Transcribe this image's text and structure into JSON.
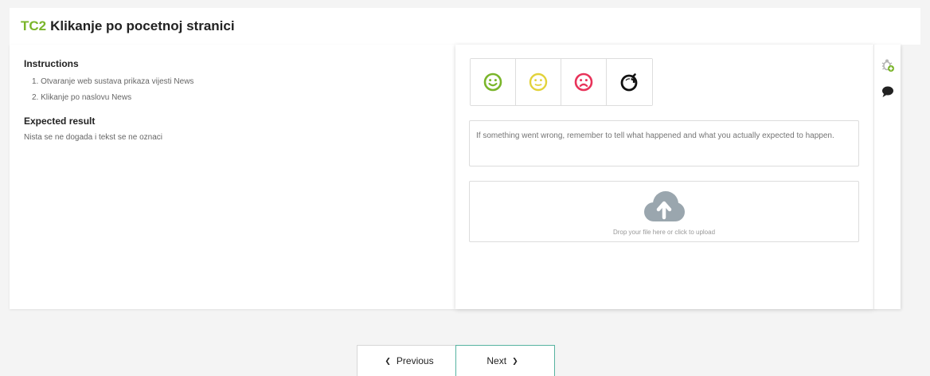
{
  "header": {
    "code": "TC2",
    "title": "Klikanje po pocetnoj stranici"
  },
  "instructions": {
    "heading": "Instructions",
    "steps": [
      "1. Otvaranje web sustava prikaza vijesti News",
      "2. Klikanje po naslovu News"
    ]
  },
  "expected": {
    "heading": "Expected result",
    "text": "Nista se ne dogada i tekst se ne oznaci"
  },
  "feedback": {
    "emojis": [
      {
        "icon": "happy-face-icon",
        "color": "#7ab52a"
      },
      {
        "icon": "neutral-face-icon",
        "color": "#e2d23a"
      },
      {
        "icon": "sad-face-icon",
        "color": "#e8335a"
      },
      {
        "icon": "bomb-icon",
        "color": "#111111"
      }
    ],
    "comment_placeholder": "If something went wrong, remember to tell what happened and what you actually expected to happen.",
    "upload_text": "Drop your file here or click to upload"
  },
  "side_icons": [
    "bug-add-icon",
    "comment-icon"
  ],
  "pager": {
    "previous_label": "Previous",
    "next_label": "Next"
  },
  "colors": {
    "accent": "#7ab52a",
    "next_border": "#56b3a0"
  }
}
